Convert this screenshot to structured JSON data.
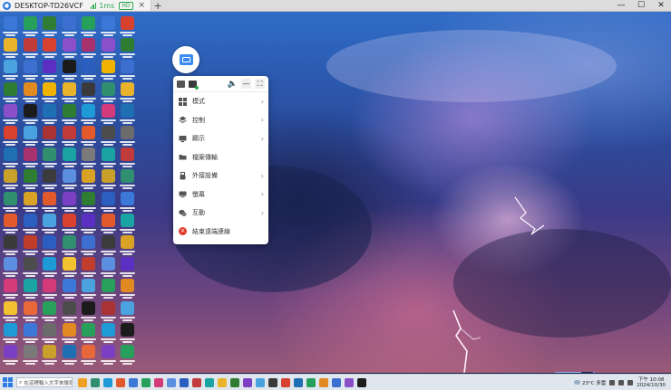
{
  "titlebar": {
    "tab_title": "DESKTOP-TD26VCF",
    "latency": "1ms",
    "quality_badge": "HD",
    "close_tab_glyph": "×",
    "new_tab_glyph": "+",
    "win_min_glyph": "—",
    "win_max_glyph": "☐",
    "win_close_glyph": "✕"
  },
  "remote_menu": {
    "volume_glyph": "🔈",
    "minimize_glyph": "—",
    "fullscreen_glyph": "⛶",
    "chevron": "›",
    "items": [
      {
        "label": "模式",
        "icon": "grid-icon",
        "has_submenu": true
      },
      {
        "label": "控制",
        "icon": "layers-icon",
        "has_submenu": true
      },
      {
        "label": "顯示",
        "icon": "monitor-icon",
        "has_submenu": true
      },
      {
        "label": "檔案傳輸",
        "icon": "folder-icon",
        "has_submenu": false
      },
      {
        "label": "外接設備",
        "icon": "usb-icon",
        "has_submenu": true
      },
      {
        "label": "螢幕",
        "icon": "screen-icon",
        "has_submenu": true
      },
      {
        "label": "互動",
        "icon": "chat-icon",
        "has_submenu": true
      },
      {
        "label": "結束遠端連線",
        "icon": "exit-icon",
        "has_submenu": false
      }
    ],
    "exit_glyph": "×"
  },
  "taskbar": {
    "search_placeholder": "在這裡輸入文字來搜尋",
    "search_glyph": "⌕",
    "weather": "23°C 多雲",
    "time": "下午 10:08",
    "date": "2024/10/30"
  },
  "colors": {
    "accent": "#2d7be5",
    "signal_green": "#2fa84f",
    "exit_red": "#e0392b",
    "menu_bg": "#ffffff",
    "taskbar_bg": "#dfe6ee"
  },
  "desktop_icons": [
    "#3b78d8",
    "#e9b42c",
    "#4aa3df",
    "#2e7d32",
    "#8a4fc9",
    "#d9412f",
    "#1f6fb5",
    "#c8a02a",
    "#2f8f6f",
    "#e25a2c",
    "#3a3a3a",
    "#5c8fe0",
    "#d43b7a",
    "#f2c230",
    "#1e9bd7",
    "#7b3fc4",
    "#26a05a",
    "#c23b3b",
    "#3d6fd1",
    "#e08a21",
    "#1c1c1c",
    "#4aa3df",
    "#a8326e",
    "#2e7d32",
    "#d9a224",
    "#2b5fbf",
    "#c13d2b",
    "#4c4c4c",
    "#1aa3a3",
    "#e9683a",
    "#3b78d8",
    "#7a7a7a",
    "#2e7d32",
    "#d9412f",
    "#5a2fc2",
    "#f0b400",
    "#1f6fb5",
    "#a33",
    "#2f8f6f",
    "#3b3b3b",
    "#e25a2c",
    "#4aa3df",
    "#2b5fbf",
    "#1e9bd7",
    "#d43b7a",
    "#26a05a",
    "#6b6b6b",
    "#c8a02a",
    "#3d6fd1",
    "#8a4fc9",
    "#1c1c1c",
    "#e9b42c",
    "#2e7d32",
    "#c23b3b",
    "#1aa3a3",
    "#5c8fe0",
    "#7b3fc4",
    "#d9412f",
    "#2f8f6f",
    "#f2c230",
    "#3b78d8",
    "#4c4c4c",
    "#e08a21",
    "#1f6fb5",
    "#26a05a",
    "#a8326e",
    "#2b5fbf",
    "#3a3a3a",
    "#1e9bd7",
    "#e25a2c",
    "#7a7a7a",
    "#d9a224",
    "#2e7d32",
    "#5a2fc2",
    "#3d6fd1",
    "#c13d2b",
    "#4aa3df",
    "#1c1c1c",
    "#26a05a",
    "#e9683a",
    "#3b78d8",
    "#8a4fc9",
    "#f0b400",
    "#2f8f6f",
    "#d43b7a",
    "#4c4c4c",
    "#1aa3a3",
    "#c8a02a",
    "#2b5fbf",
    "#e25a2c",
    "#3b3b3b",
    "#5c8fe0",
    "#26a05a",
    "#a33",
    "#1e9bd7",
    "#7b3fc4",
    "#d9412f",
    "#2e7d32",
    "#3d6fd1",
    "#e9b42c",
    "#1f6fb5",
    "#6b6b6b",
    "#c23b3b",
    "#2f8f6f",
    "#3b78d8",
    "#1aa3a3",
    "#d9a224",
    "#5a2fc2",
    "#e08a21",
    "#4aa3df",
    "#1c1c1c",
    "#26a05a",
    "#2b5fbf",
    "#e25a2c",
    "#7a7a7a",
    "#d43b7a",
    "#2e7d32",
    "#3d6fd1",
    "#f2c230",
    "#4c4c4c"
  ],
  "taskbar_apps": [
    "#f0a020",
    "#2f8f6f",
    "#1e9bd7",
    "#e25a2c",
    "#3b78d8",
    "#26a05a",
    "#d43b7a",
    "#5c8fe0",
    "#2b5fbf",
    "#c23b3b",
    "#1aa3a3",
    "#e9b42c",
    "#2e7d32",
    "#7b3fc4",
    "#4aa3df",
    "#3a3a3a",
    "#d9412f",
    "#1f6fb5",
    "#26a05a",
    "#e08a21",
    "#3d6fd1",
    "#8a4fc9",
    "#1c1c1c"
  ]
}
